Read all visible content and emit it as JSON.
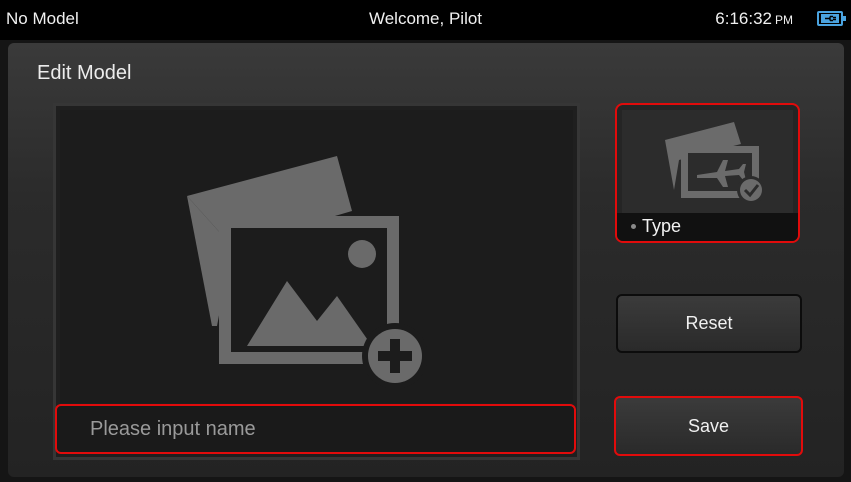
{
  "status_bar": {
    "model_name": "No Model",
    "welcome": "Welcome, Pilot",
    "time": "6:16:32",
    "ampm": "PM",
    "battery_icon": "battery-charging-icon",
    "battery_color": "#4aa3df"
  },
  "edit_model": {
    "title": "Edit Model",
    "image_icon": "add-photo-icon",
    "name_input": {
      "value": "",
      "placeholder": "Please input name"
    },
    "type_tile": {
      "label": "Type",
      "icon": "airplane-photo-check-icon"
    },
    "reset_label": "Reset",
    "save_label": "Save"
  },
  "colors": {
    "highlight": "#e10b0b",
    "icon_gray": "#666666",
    "background": "#151515"
  }
}
